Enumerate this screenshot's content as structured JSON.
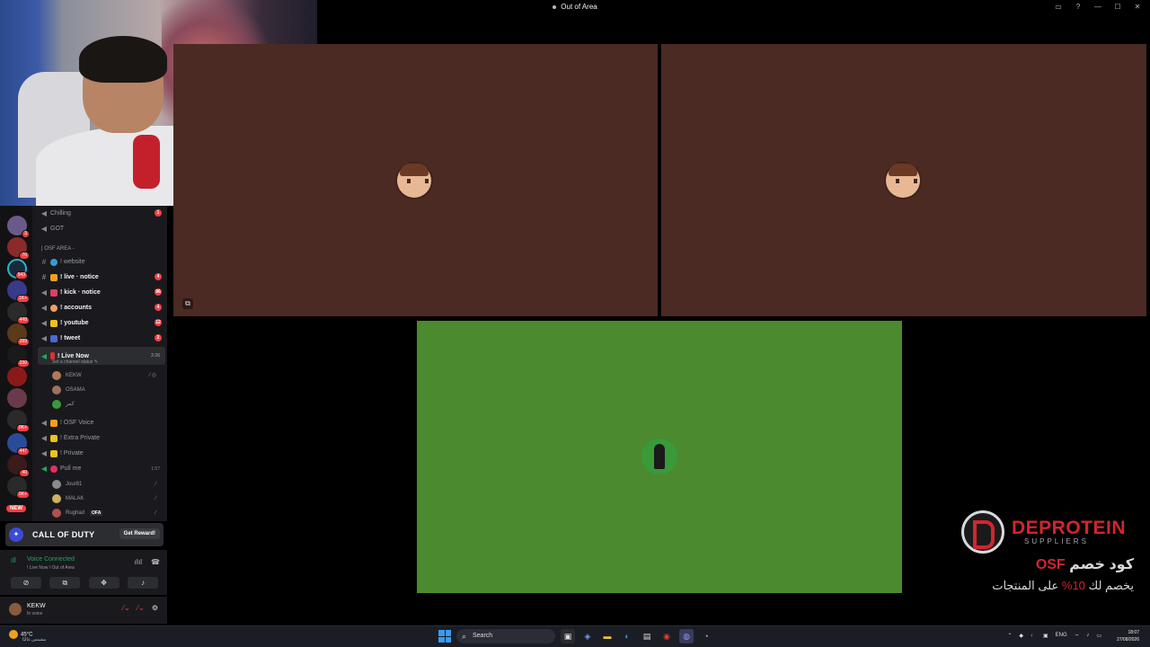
{
  "window": {
    "title": "Out of Area"
  },
  "sidebar": {
    "server_badges": [
      "3",
      "70",
      "543",
      "1K+",
      "448",
      "289",
      "230",
      "",
      "8K+",
      "447",
      "40",
      "9K+",
      "NEW"
    ],
    "channels": [
      {
        "name": "Chilling",
        "type": "voice",
        "badge": "1",
        "bold": false
      },
      {
        "name": "GOT",
        "type": "voice",
        "badge": "",
        "bold": false
      }
    ],
    "category": "| OSF AREA -",
    "text_channels": [
      {
        "name": "! website",
        "type": "text",
        "badge": "",
        "bold": false
      },
      {
        "name": "! live · notice",
        "type": "announce",
        "badge": "4",
        "bold": true
      },
      {
        "name": "! kick · notice",
        "type": "announce",
        "badge": "96",
        "bold": true
      },
      {
        "name": "! accounts",
        "type": "announce",
        "badge": "4",
        "bold": true
      },
      {
        "name": "! youtube",
        "type": "announce",
        "badge": "12",
        "bold": true
      },
      {
        "name": "! tweet",
        "type": "announce",
        "badge": "2",
        "bold": true
      }
    ],
    "active_voice": {
      "name": "! Live Now",
      "time": "3:36",
      "status_hint": "Set a channel status"
    },
    "live_members": [
      "KEKW",
      "OSAMA",
      "كمر"
    ],
    "more_voice": [
      {
        "name": "! OSF Voice",
        "time": ""
      },
      {
        "name": "! Extra Private",
        "time": ""
      },
      {
        "name": "! Private",
        "time": ""
      },
      {
        "name": "Pull me",
        "time": "1:57"
      }
    ],
    "pull_members": [
      {
        "name": "Jour81",
        "tag": ""
      },
      {
        "name": "MALAK",
        "tag": ""
      },
      {
        "name": "Rughad",
        "tag": "OFA"
      }
    ]
  },
  "promo": {
    "brand": "CALL OF DUTY",
    "cta": "Get Reward!"
  },
  "voice": {
    "status": "Voice Connected",
    "path": "! Live Now / Out of Area"
  },
  "user": {
    "name": "KEKW",
    "status": "In voice"
  },
  "sponsor": {
    "name": "DEPROTEIN",
    "sub": "SUPPLIERS",
    "code_label": "كود خصم",
    "code": "OSF",
    "discount_pre": "يخصم لك",
    "discount_value": "10%",
    "discount_post": "على المنتجات"
  },
  "taskbar": {
    "temperature": "45°C",
    "weather_text": "مشمس غالبًا",
    "search_placeholder": "Search",
    "language": "ENG",
    "time": "18:07",
    "date": "27/08/2026"
  },
  "colors": {
    "tile_brown": "#4a2a22",
    "tile_green": "#4b8a2f",
    "accent_red": "#d2252e",
    "online_green": "#23a55a"
  }
}
